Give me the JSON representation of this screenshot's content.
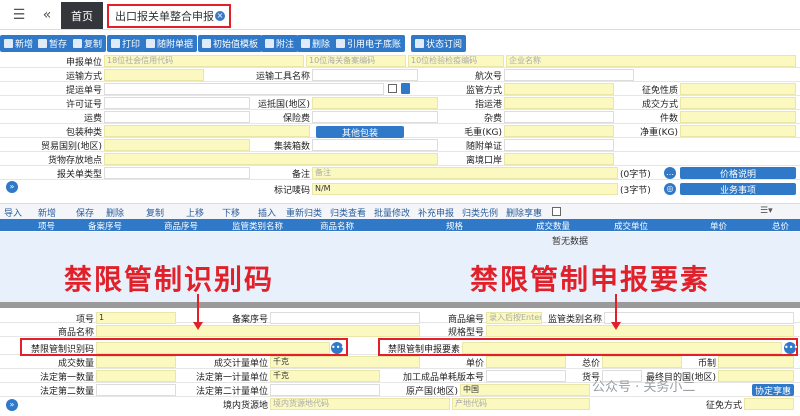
{
  "tabs": {
    "home": "首页",
    "current": "出口报关单整合申报"
  },
  "toolbar": [
    "新增",
    "暂存",
    "复制",
    "打印",
    "随附单据",
    "初始值模板",
    "附注",
    "删除",
    "引用电子底账",
    "状态订阅"
  ],
  "form": {
    "declarant": {
      "label": "申报单位",
      "code_ph": "18位社会信用代码",
      "customs_ph": "10位海关备案编码",
      "insp_ph": "10位检验检疫编码",
      "name_ph": "企业名称"
    },
    "labels": {
      "transport_mode": "运输方式",
      "conveyance_name": "运输工具名称",
      "voyage_no": "航次号",
      "bill_no": "提运单号",
      "supervision_mode": "监管方式",
      "levy_nature": "征免性质",
      "license_no": "许可证号",
      "dest_country": "运抵国(地区)",
      "dest_port": "指运港",
      "deal_mode": "成交方式",
      "freight": "运费",
      "insurance": "保险费",
      "misc_fee": "杂费",
      "pieces": "件数",
      "pack_type": "包装种类",
      "gross_weight": "毛重(KG)",
      "net_weight": "净重(KG)",
      "trade_country": "贸易国别(地区)",
      "container_count": "集装箱数",
      "attached_docs": "随附单证",
      "goods_location": "货物存放地点",
      "exit_port": "离境口岸",
      "decl_type": "报关单类型",
      "remarks": "备注",
      "marks": "标记唛码"
    },
    "other_pack_btn": "其他包装",
    "remarks_ph": "备注",
    "marks_value": "N/M",
    "remarks_count": "(0字节)",
    "marks_count": "(3字节)",
    "price_btn": "价格说明",
    "business_btn": "业务事项"
  },
  "list_toolbar": [
    "导入",
    "新增",
    "保存",
    "删除",
    "复制",
    "上移",
    "下移",
    "插入",
    "重新归类",
    "归类查看",
    "批量修改",
    "补充申报",
    "归类先例",
    "删除享惠"
  ],
  "table": {
    "headers": [
      "项号",
      "备案序号",
      "商品序号",
      "监管类别名称",
      "商品名称",
      "规格",
      "成交数量",
      "成交单位",
      "单价",
      "总价"
    ],
    "empty_text": "暂无数据"
  },
  "annotations": {
    "left": "禁限管制识别码",
    "right": "禁限管制申报要素"
  },
  "detail": {
    "item_no_label": "项号",
    "item_no_value": "1",
    "record_no_label": "备案序号",
    "goods_code_label": "商品编号",
    "goods_code_ph": "录入后按Enter键",
    "supervision_label": "监管类别名称",
    "goods_name_label": "商品名称",
    "spec_label": "规格型号",
    "restrict_code_label": "禁限管制识别码",
    "restrict_elem_label": "禁限管制申报要素",
    "deal_qty_label": "成交数量",
    "deal_unit_label": "成交计量单位",
    "deal_unit_value": "千克",
    "unit_price_label": "单价",
    "total_price_label": "总价",
    "currency_label": "币制",
    "legal_qty1_label": "法定第一数量",
    "legal_unit1_label": "法定第一计量单位",
    "legal_unit1_value": "千克",
    "processing_label": "加工成品单耗版本号",
    "goods_no_label": "货号",
    "final_dest_label": "最终目的国(地区)",
    "legal_qty2_label": "法定第二数量",
    "legal_unit2_label": "法定第二计量单位",
    "origin_label": "原产国(地区)",
    "origin_value": "中国",
    "source_label": "境内货源地",
    "source_ph": "境内货源地代码",
    "origin_code_ph": "产地代码",
    "exemption_label": "征免方式",
    "agreement_btn": "协定享惠"
  },
  "watermark": "公众号 · 关务小二"
}
